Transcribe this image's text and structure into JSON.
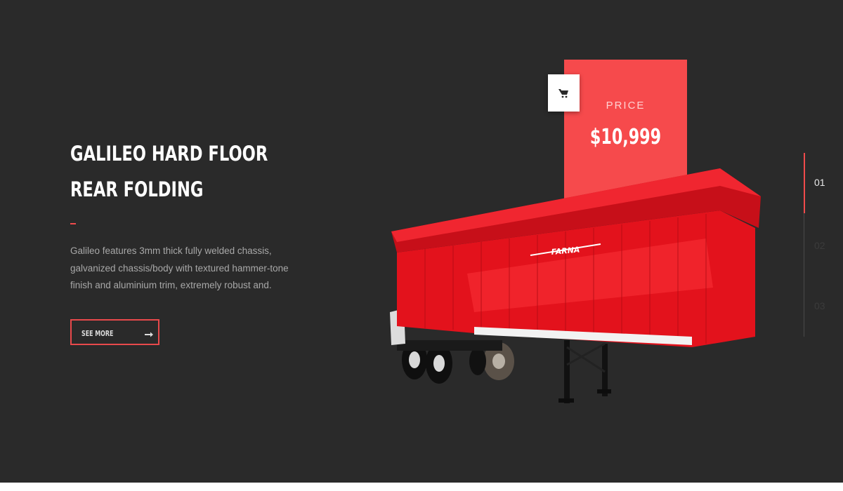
{
  "hero": {
    "title_lines": [
      "GALILEO HARD FLOOR",
      "REAR FOLDING"
    ],
    "description": "Galileo features 3mm thick fully welded chassis, galvanized chassis/body with textured hammer-tone finish and aluminium trim, extremely robust and.",
    "see_more_label": "SEE MORE"
  },
  "price": {
    "label": "PRICE",
    "value": "$10,999"
  },
  "product": {
    "brand_text": "FARNA"
  },
  "slider": {
    "slides": [
      "01",
      "02",
      "03"
    ],
    "active_index": 0
  },
  "colors": {
    "background": "#2a2a2a",
    "accent": "#f64a4c",
    "button_border": "#e8494b",
    "trailer_red": "#e3121c"
  },
  "icons": [
    "cart-icon",
    "arrow-right-icon"
  ]
}
